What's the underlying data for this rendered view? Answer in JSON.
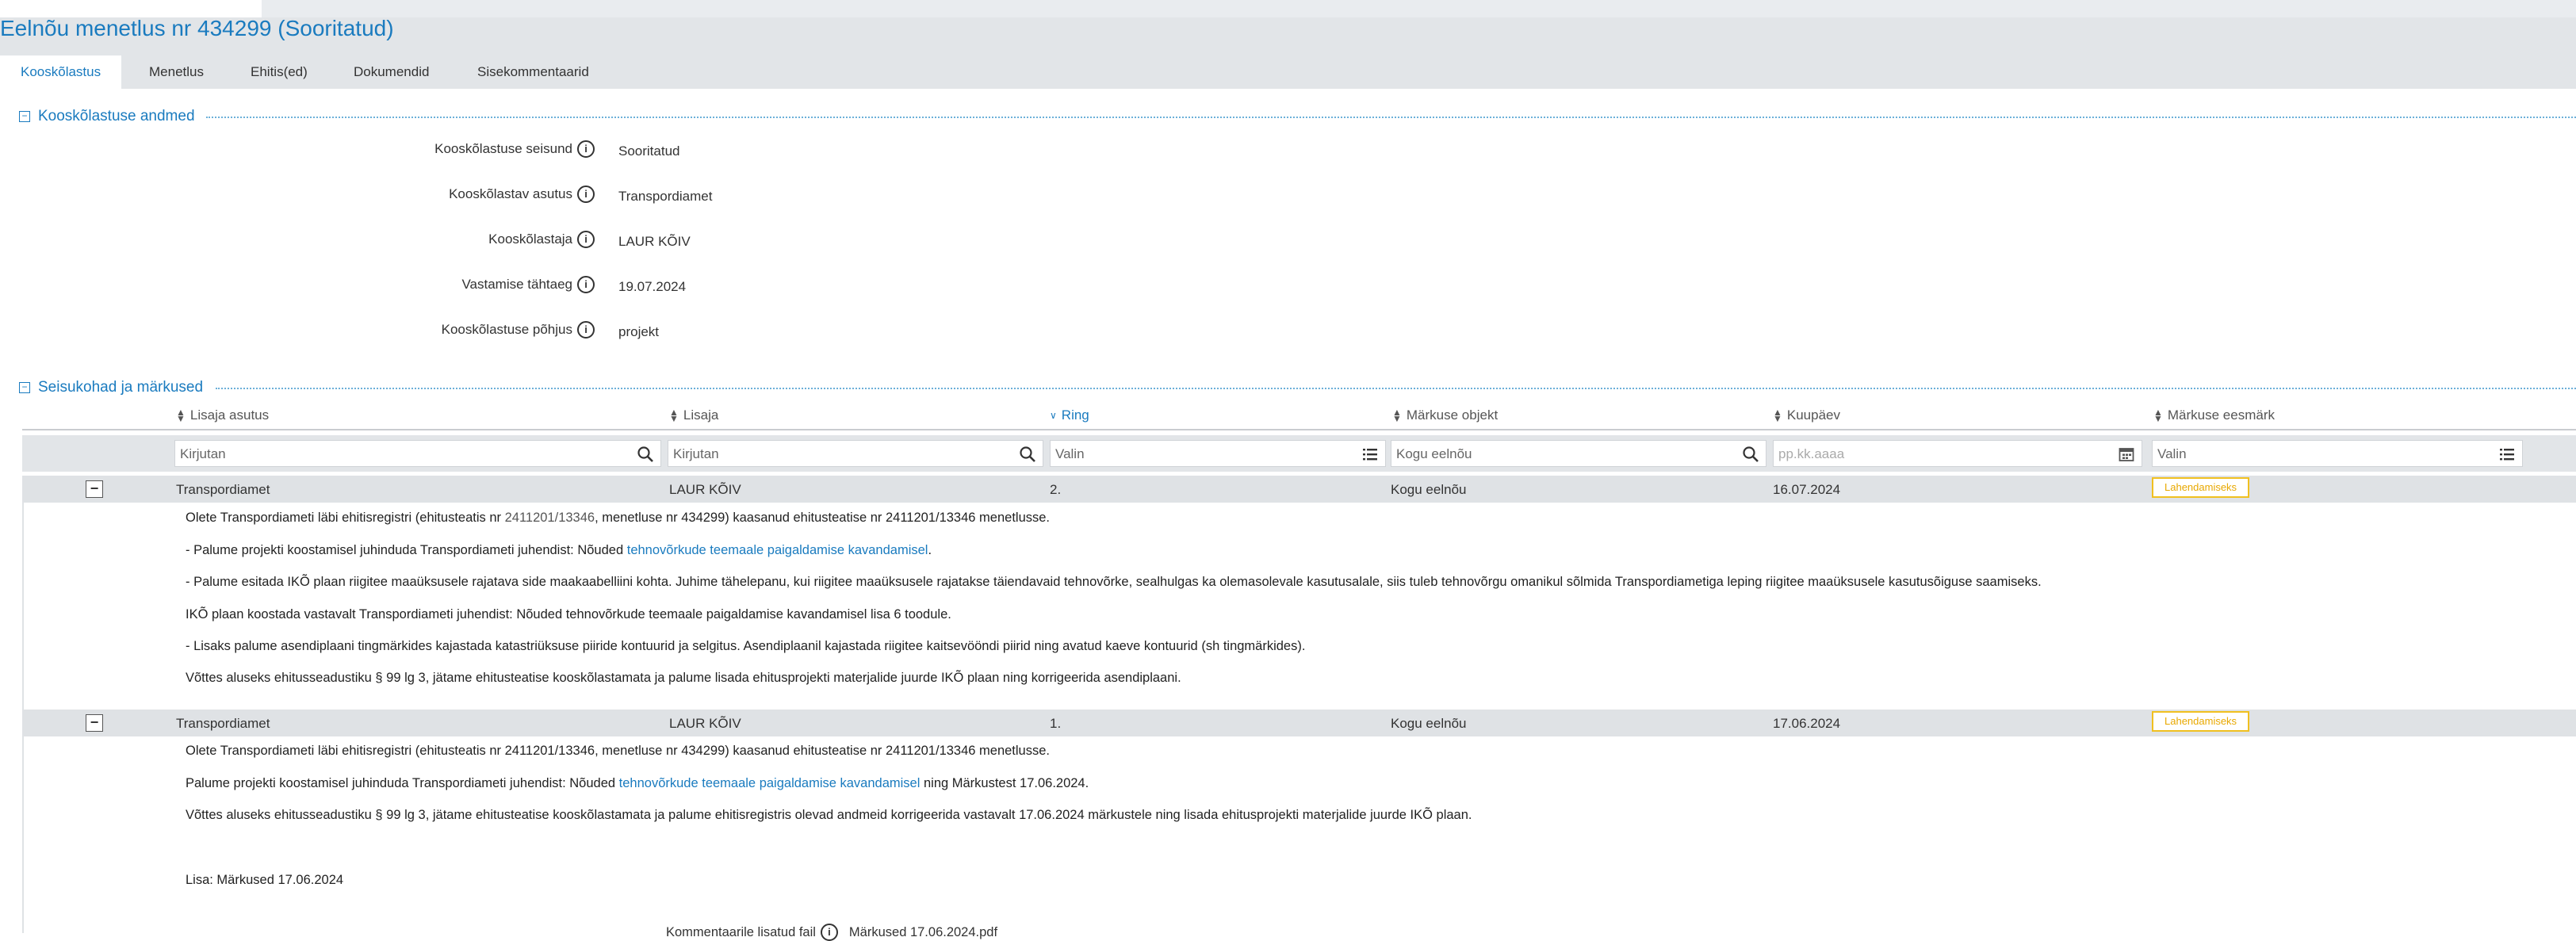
{
  "page": {
    "title": "Eelnõu menetlus nr 434299 (Sooritatud)"
  },
  "tabs": [
    {
      "label": "Kooskõlastus",
      "active": true
    },
    {
      "label": "Menetlus",
      "active": false
    },
    {
      "label": "Ehitis(ed)",
      "active": false
    },
    {
      "label": "Dokumendid",
      "active": false
    },
    {
      "label": "Sisekommentaarid",
      "active": false
    }
  ],
  "approval_details": {
    "legend": "Kooskõlastuse andmed",
    "collapse_symbol": "−",
    "fields": [
      {
        "label": "Kooskõlastuse seisund",
        "value": "Sooritatud"
      },
      {
        "label": "Kooskõlastav asutus",
        "value": "Transpordiamet"
      },
      {
        "label": "Kooskõlastaja",
        "value": "LAUR KÕIV"
      },
      {
        "label": "Vastamise tähtaeg",
        "value": "19.07.2024"
      },
      {
        "label": "Kooskõlastuse põhjus",
        "value": "projekt"
      }
    ]
  },
  "positions": {
    "legend": "Seisukohad ja märkused",
    "collapse_symbol": "−",
    "columns": [
      {
        "label": "Lisaja asutus",
        "sorted": false
      },
      {
        "label": "Lisaja",
        "sorted": false
      },
      {
        "label": "Ring",
        "sorted": true
      },
      {
        "label": "Märkuse objekt",
        "sorted": false
      },
      {
        "label": "Kuupäev",
        "sorted": false
      },
      {
        "label": "Märkuse eesmärk",
        "sorted": false
      }
    ],
    "filters": [
      {
        "placeholder": "Kirjutan",
        "icon": "search-icon"
      },
      {
        "placeholder": "Kirjutan",
        "icon": "search-icon"
      },
      {
        "placeholder": "Valin",
        "icon": "list-icon"
      },
      {
        "value": "Kogu eelnõu",
        "icon": "search-icon"
      },
      {
        "placeholder": "pp.kk.aaaa",
        "icon": "calendar-icon"
      },
      {
        "placeholder": "Valin",
        "icon": "list-icon"
      }
    ],
    "rows": [
      {
        "institution": "Transpordiamet",
        "author": "LAUR KÕIV",
        "round": "2.",
        "object": "Kogu eelnõu",
        "date": "16.07.2024",
        "purpose": "Lahendamiseks",
        "lines": {
          "l1": "Olete Transpordiameti läbi ehitisregistri (ehitusteatis nr ",
          "l1_mid": "2411201/13346",
          "l1_end": ", menetluse nr 434299) kaasanud ehitusteatise nr 2411201/13346 menetlusse.",
          "l2": "-  Palume projekti koostamisel juhinduda Transpordiameti juhendist: Nõuded ",
          "l2_link": "tehnovõrkude teemaale paigaldamise kavandamisel",
          "l2_end": ".",
          "l3": "-  Palume esitada IKÕ plaan riigitee maaüksusele rajatava side maakaabelliini kohta. Juhime tähelepanu, kui riigitee maaüksusele rajatakse täiendavaid tehnovõrke, sealhulgas ka olemasolevale kasutusalale, siis tuleb tehnovõrgu omanikul sõlmida Transpordiametiga leping riigitee maaüksusele kasutusõiguse saamiseks.",
          "l4": " IKÕ plaan koostada vastavalt Transpordiameti juhendist: Nõuded tehnovõrkude teemaale paigaldamise kavandamisel lisa 6 toodule.",
          "l5": "-  Lisaks palume asendiplaani tingmärkides kajastada katastriüksuse piiride kontuurid ja selgitus. Asendiplaanil kajastada riigitee kaitsevööndi piirid ning avatud kaeve kontuurid (sh tingmärkides).",
          "l6": "Võttes aluseks ehitusseadustiku § 99 lg 3, jätame ehitusteatise kooskõlastamata ja palume lisada ehitusprojekti materjalide juurde IKÕ plaan ning korrigeerida asendiplaani."
        }
      },
      {
        "institution": "Transpordiamet",
        "author": "LAUR KÕIV",
        "round": "1.",
        "object": "Kogu eelnõu",
        "date": "17.06.2024",
        "purpose": "Lahendamiseks",
        "lines": {
          "l1": "Olete Transpordiameti läbi ehitisregistri (ehitusteatis nr 2411201/13346, menetluse nr 434299) kaasanud ehitusteatise nr 2411201/13346 menetlusse.",
          "l2": "Palume projekti koostamisel juhinduda Transpordiameti juhendist: Nõuded ",
          "l2_link": "tehnovõrkude teemaale paigaldamise kavandamisel",
          "l2_end": " ning Märkustest 17.06.2024.",
          "l3": "Võttes aluseks ehitusseadustiku § 99 lg 3, jätame ehitusteatise kooskõlastamata ja palume ehitisregistris olevad andmeid korrigeerida vastavalt 17.06.2024 märkustele ning lisada ehitusprojekti materjalide juurde IKÕ plaan.",
          "l4": "Lisa: Märkused 17.06.2024"
        }
      }
    ],
    "partial_footer": "Kommentaarile lisatud fail",
    "partial_footer_file": "Märkused 17.06.2024.pdf"
  }
}
